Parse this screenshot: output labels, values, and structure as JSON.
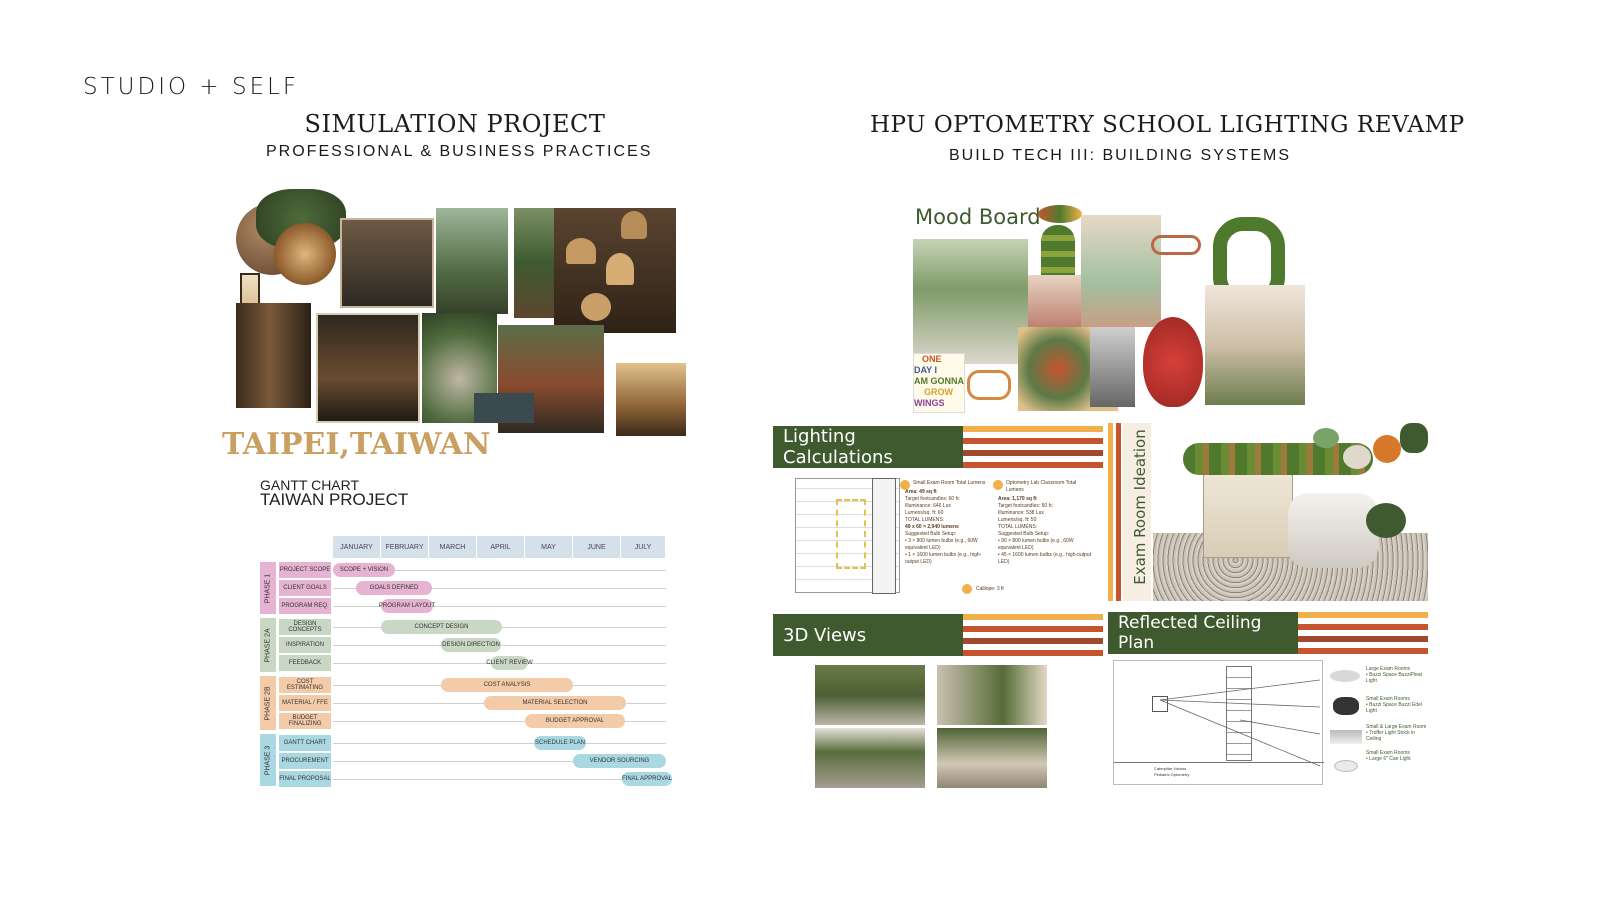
{
  "header": {
    "studio": "STUDIO + SELF"
  },
  "left": {
    "title": "SIMULATION PROJECT",
    "subtitle": "PROFESSIONAL & BUSINESS PRACTICES",
    "location": "TAIPEI,TAIWAN",
    "gantt": {
      "title_line1": "GANTT CHART",
      "title_line2": "TAIWAN PROJECT",
      "months": [
        "JANUARY",
        "FEBRUARY",
        "MARCH",
        "APRIL",
        "MAY",
        "JUNE",
        "JULY"
      ],
      "phases": [
        "PHASE 1",
        "PHASE 2A",
        "PHASE 2B",
        "PHASE 3"
      ],
      "tasks": [
        "PROJECT SCOPE",
        "CLIENT GOALS",
        "PROGRAM REQ.",
        "DESIGN CONCEPTS",
        "INSPIRATION",
        "FEEDBACK",
        "COST ESTIMATING",
        "MATERIAL / FFE",
        "BUDGET FINALIZING",
        "GANTT CHART",
        "PROCUREMENT",
        "FINAL PROPOSAL"
      ],
      "bars": [
        "SCOPE + VISION",
        "GOALS DEFINED",
        "PROGRAM LAYOUT",
        "CONCEPT DESIGN",
        "DESIGN DIRECTION",
        "CLIENT REVIEW",
        "COST ANALYSIS",
        "MATERIAL SELECTION",
        "BUDGET APPROVAL",
        "SCHEDULE PLAN",
        "VENDOR SOURCING",
        "FINAL APPROVAL"
      ],
      "colors": {
        "phase1": "#e6b3d2",
        "phase2a": "#c9d8c4",
        "phase2b": "#f4cba8",
        "phase3": "#a9d8e3"
      }
    }
  },
  "right": {
    "title": "HPU OPTOMETRY SCHOOL LIGHTING REVAMP",
    "subtitle": "BUILD TECH III: BUILDING SYSTEMS",
    "mood_board": "Mood Board",
    "mood_text": [
      "ONE",
      "DAY I",
      "AM GONNA",
      "GROW",
      "WINGS"
    ],
    "lighting_calc": "Lighting Calculations",
    "exam_room": "Exam Room Ideation",
    "views_3d": "3D Views",
    "reflected_ceiling": "Reflected Ceiling Plan",
    "calc_left": [
      "Small Exam Room Total Lumens",
      "Area: 49 sq ft",
      "Target footcandles: 60 fc",
      "Illuminance: 646 Lux",
      "Lumens/sq. ft: 60",
      "TOTAL LUMENS:",
      "49 x 60 = 2,940 lumens",
      "Suggested Bulb Setup:",
      "• 3 × 800 lumen bulbs (e.g., 60W equivalent LED)",
      "• 1 × 1600 lumen bulbs (e.g., high-output LED)"
    ],
    "calc_right": [
      "Optometry Lab Classroom Total Lumens",
      "Area: 1,170 sq ft",
      "Target footcandles: 50 fc",
      "Illuminance: 538 Lux",
      "Lumens/sq. ft: 50",
      "TOTAL LUMENS:",
      "Suggested Bulb Setup:",
      "• 90 × 800 lumen bulbs (e.g., 60W equivalent LED)",
      "• 45 × 1600 lumen bulbs (e.g., high-output LED)"
    ],
    "calc_note": "Calliope: 3 ft",
    "rcp_labels": [
      "Large Exam Rooms",
      "• Buzzi Space BuzziPleat Light",
      "Small Exam Rooms",
      "• Buzzi Space Buzzi Edel Light",
      "Small & Large Exam Room",
      "• Troffer Light Stock in Ceiling",
      "Small Exam Rooms",
      "• Large 6\" Can Light"
    ],
    "rcp_title_block": [
      "Caterpillar Visions",
      "Pediatric Optometry"
    ],
    "colors": {
      "green": "#3f5a2f",
      "orange": "#f2b04b",
      "rust": "#c6552f",
      "cream": "#f7eee3",
      "gold": "#c9a062"
    }
  }
}
